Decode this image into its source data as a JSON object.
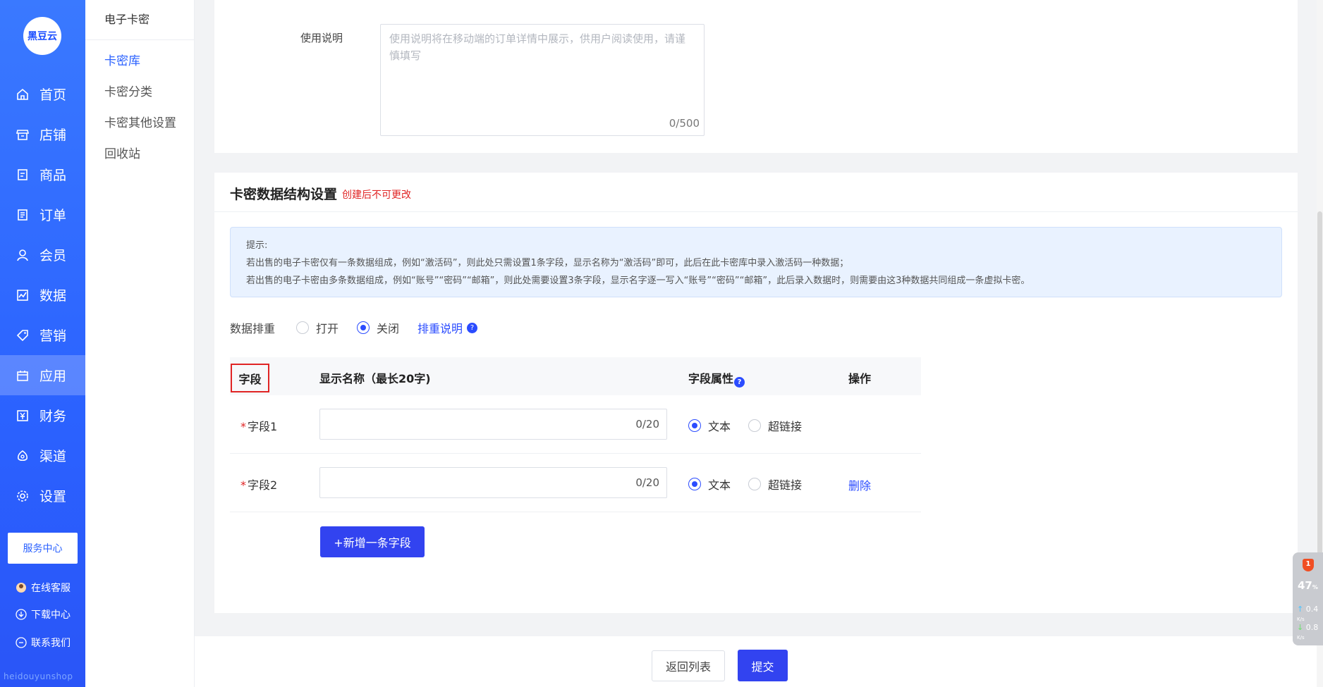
{
  "brand": {
    "logo_text": "黑豆云",
    "watermark": "heidouyunshop"
  },
  "colors": {
    "primary": "#2b62ff",
    "accent": "#3243f0",
    "danger": "#e02424"
  },
  "nav": {
    "items": [
      {
        "label": "首页",
        "icon": "home-icon"
      },
      {
        "label": "店铺",
        "icon": "store-icon"
      },
      {
        "label": "商品",
        "icon": "goods-icon"
      },
      {
        "label": "订单",
        "icon": "order-icon"
      },
      {
        "label": "会员",
        "icon": "user-icon"
      },
      {
        "label": "数据",
        "icon": "chart-icon"
      },
      {
        "label": "营销",
        "icon": "tag-icon"
      },
      {
        "label": "应用",
        "icon": "app-icon",
        "active": true
      },
      {
        "label": "财务",
        "icon": "finance-icon"
      },
      {
        "label": "渠道",
        "icon": "channel-icon"
      },
      {
        "label": "设置",
        "icon": "gear-icon"
      }
    ],
    "service_center": "服务中心",
    "online_service": "在线客服",
    "download_center": "下载中心",
    "contact_us": "联系我们"
  },
  "subnav": {
    "title": "电子卡密",
    "items": [
      "卡密库",
      "卡密分类",
      "卡密其他设置",
      "回收站"
    ]
  },
  "usage": {
    "label": "使用说明",
    "placeholder": "使用说明将在移动端的订单详情中展示，供用户阅读使用，请谨慎填写",
    "count": "0/500"
  },
  "structure": {
    "title": "卡密数据结构设置",
    "warning": "创建后不可更改",
    "tip_title": "提示:",
    "tip_line1": "若出售的电子卡密仅有一条数据组成，例如“激活码”，则此处只需设置1条字段，显示名称为“激活码”即可，此后在此卡密库中录入激活码一种数据；",
    "tip_line2": "若出售的电子卡密由多条数据组成，例如“账号”“密码”“邮箱”，则此处需要设置3条字段，显示名字逐一写入“账号”“密码”“邮箱”，此后录入数据时，则需要由这3种数据共同组成一条虚拟卡密。",
    "dedupe_label": "数据排重",
    "dedupe_on": "打开",
    "dedupe_off": "关闭",
    "dedupe_help": "排重说明",
    "columns": {
      "field": "字段",
      "name": "显示名称（最长20字)",
      "attr": "字段属性",
      "op": "操作"
    },
    "rows": [
      {
        "label": "字段1",
        "count": "0/20",
        "opt_text": "文本",
        "opt_link": "超链接",
        "delete": ""
      },
      {
        "label": "字段2",
        "count": "0/20",
        "opt_text": "文本",
        "opt_link": "超链接",
        "delete": "删除"
      }
    ],
    "add_field": "+新增一条字段"
  },
  "footer": {
    "back": "返回列表",
    "submit": "提交"
  },
  "widget": {
    "badge": "1",
    "percent": "47",
    "percent_unit": "%",
    "up": "0.4",
    "down": "0.8",
    "unit": "K/s"
  }
}
